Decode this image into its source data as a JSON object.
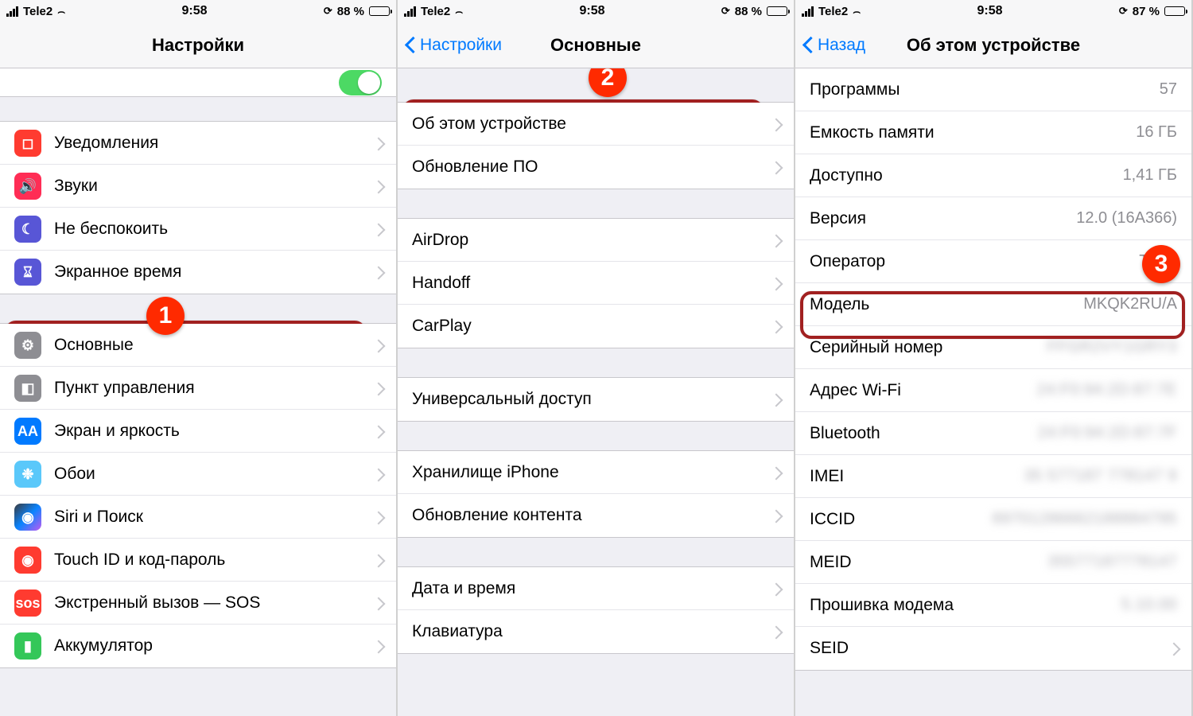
{
  "statusbar": {
    "carrier": "Tele2",
    "time": "9:58",
    "battery1": "88 %",
    "battery2": "88 %",
    "battery3": "87 %",
    "battery_fill1": 88,
    "battery_fill3": 87
  },
  "screen1": {
    "title": "Настройки",
    "rows1": [
      {
        "id": "notifications",
        "label": "Уведомления",
        "icon_bg": "ic-red",
        "glyph": "◻︎"
      },
      {
        "id": "sounds",
        "label": "Звуки",
        "icon_bg": "ic-pink",
        "glyph": "🔊"
      },
      {
        "id": "dnd",
        "label": "Не беспокоить",
        "icon_bg": "ic-purple",
        "glyph": "☾"
      },
      {
        "id": "screentime",
        "label": "Экранное время",
        "icon_bg": "ic-purple",
        "glyph": "⌛︎"
      }
    ],
    "rows2": [
      {
        "id": "general",
        "label": "Основные",
        "icon_bg": "ic-grey",
        "glyph": "⚙︎"
      },
      {
        "id": "control-center",
        "label": "Пункт управления",
        "icon_bg": "ic-grey",
        "glyph": "◧"
      },
      {
        "id": "display",
        "label": "Экран и яркость",
        "icon_bg": "ic-blue",
        "glyph": "AA"
      },
      {
        "id": "wallpaper",
        "label": "Обои",
        "icon_bg": "ic-teal",
        "glyph": "❉"
      },
      {
        "id": "siri",
        "label": "Siri и Поиск",
        "icon_bg": "ic-siri",
        "glyph": "◉"
      },
      {
        "id": "touchid",
        "label": "Touch ID и код-пароль",
        "icon_bg": "ic-touch",
        "glyph": "◉"
      },
      {
        "id": "sos",
        "label": "Экстренный вызов — SOS",
        "icon_bg": "ic-sos",
        "glyph": "sos"
      },
      {
        "id": "battery",
        "label": "Аккумулятор",
        "icon_bg": "ic-green",
        "glyph": "▮"
      }
    ],
    "badge": "1"
  },
  "screen2": {
    "back": "Настройки",
    "title": "Основные",
    "g1": [
      {
        "id": "about",
        "label": "Об этом устройстве"
      },
      {
        "id": "swupdate",
        "label": "Обновление ПО"
      }
    ],
    "g2": [
      {
        "id": "airdrop",
        "label": "AirDrop"
      },
      {
        "id": "handoff",
        "label": "Handoff"
      },
      {
        "id": "carplay",
        "label": "CarPlay"
      }
    ],
    "g3": [
      {
        "id": "accessibility",
        "label": "Универсальный доступ"
      }
    ],
    "g4": [
      {
        "id": "storage",
        "label": "Хранилище iPhone"
      },
      {
        "id": "refresh",
        "label": "Обновление контента"
      }
    ],
    "g5": [
      {
        "id": "datetime",
        "label": "Дата и время"
      },
      {
        "id": "keyboard",
        "label": "Клавиатура"
      }
    ],
    "badge": "2"
  },
  "screen3": {
    "back": "Назад",
    "title": "Об этом устройстве",
    "rows": [
      {
        "id": "apps",
        "label": "Программы",
        "value": "57",
        "blur": false
      },
      {
        "id": "capacity",
        "label": "Емкость памяти",
        "value": "16 ГБ",
        "blur": false
      },
      {
        "id": "available",
        "label": "Доступно",
        "value": "1,41 ГБ",
        "blur": false
      },
      {
        "id": "version",
        "label": "Версия",
        "value": "12.0 (16A366)",
        "blur": false
      },
      {
        "id": "carrier-op",
        "label": "Оператор",
        "value": "Tele2",
        "blur": false
      },
      {
        "id": "model",
        "label": "Модель",
        "value": "MKQK2RU/A",
        "blur": false
      },
      {
        "id": "serial",
        "label": "Серийный номер",
        "value": "FFGR2VY1GRY3",
        "blur": true
      },
      {
        "id": "wifi",
        "label": "Адрес Wi-Fi",
        "value": "24:F0:94:2D:87:7E",
        "blur": true
      },
      {
        "id": "bluetooth",
        "label": "Bluetooth",
        "value": "24:F0:94:2D:87:7F",
        "blur": true
      },
      {
        "id": "imei",
        "label": "IMEI",
        "value": "35 577187 778147 9",
        "blur": true
      },
      {
        "id": "iccid",
        "label": "ICCID",
        "value": "89701286662188884795",
        "blur": true
      },
      {
        "id": "meid",
        "label": "MEID",
        "value": "35577187778147",
        "blur": true
      },
      {
        "id": "modem",
        "label": "Прошивка модема",
        "value": "5.10.00",
        "blur": true
      },
      {
        "id": "seid",
        "label": "SEID",
        "value": "",
        "blur": false,
        "chev": true
      }
    ],
    "badge": "3"
  }
}
